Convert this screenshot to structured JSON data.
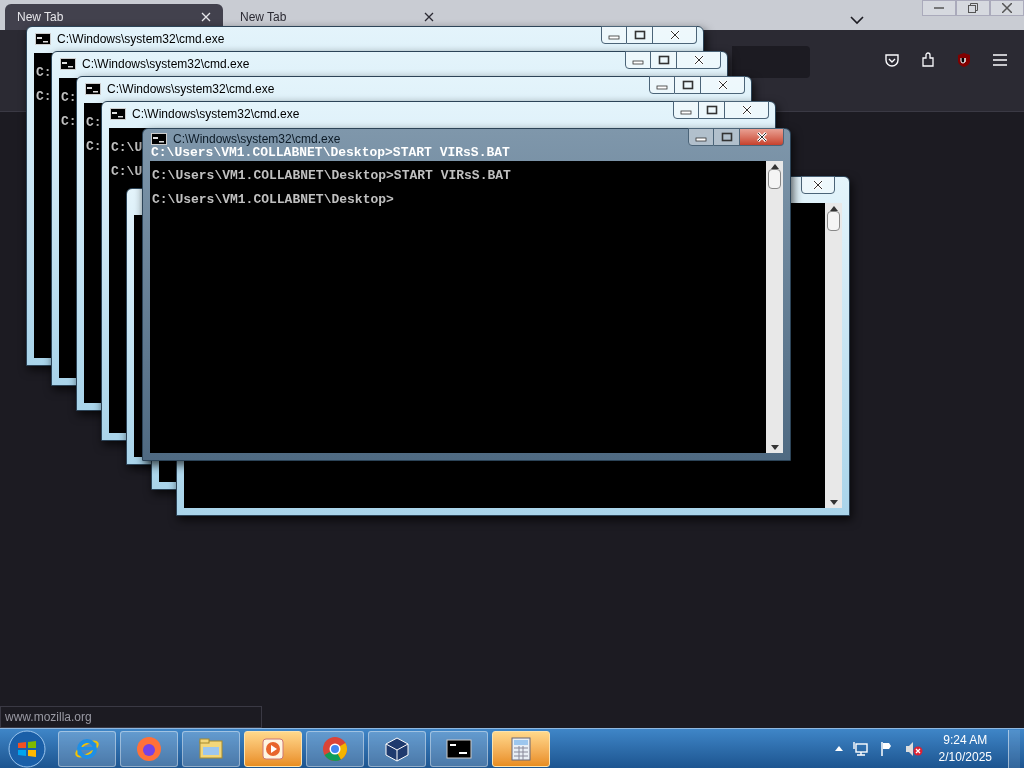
{
  "browser": {
    "tabs": [
      {
        "label": "New Tab",
        "selected": true
      },
      {
        "label": "New Tab",
        "selected": false
      }
    ],
    "status_text": "www.mozilla.org"
  },
  "windows": [
    {
      "kind": "stacked",
      "title": "C:\\Windows\\system32\\cmd.exe",
      "lines": [
        "C:",
        "C:"
      ]
    },
    {
      "kind": "stacked",
      "title": "C:\\Windows\\system32\\cmd.exe",
      "lines": [
        "C:",
        "C:"
      ]
    },
    {
      "kind": "stacked",
      "title": "C:\\Windows\\system32\\cmd.exe",
      "lines": [
        "C:",
        "C:"
      ]
    },
    {
      "kind": "stacked",
      "title": "C:\\Windows\\system32\\cmd.exe",
      "lines": [
        "C:\\U",
        "C:\\U"
      ]
    },
    {
      "kind": "plain"
    },
    {
      "kind": "plain"
    },
    {
      "kind": "trailing"
    },
    {
      "kind": "front",
      "title": "C:\\Windows\\system32\\cmd.exe",
      "ghost_line": "C:\\Users\\VM1.COLLABNET\\Desktop>START VIRsS.BAT",
      "lines": [
        "C:\\Users\\VM1.COLLABNET\\Desktop>START VIRsS.BAT",
        "C:\\Users\\VM1.COLLABNET\\Desktop>"
      ]
    }
  ],
  "taskbar": {
    "buttons": [
      {
        "kind": "ie",
        "flashing": false
      },
      {
        "kind": "firefox",
        "flashing": false
      },
      {
        "kind": "explorer",
        "flashing": false
      },
      {
        "kind": "media",
        "flashing": true
      },
      {
        "kind": "chrome",
        "flashing": false
      },
      {
        "kind": "virtualbox",
        "flashing": false
      },
      {
        "kind": "cmd",
        "flashing": false
      },
      {
        "kind": "calculator",
        "flashing": true
      }
    ],
    "time": "9:24 AM",
    "date": "2/10/2025"
  }
}
